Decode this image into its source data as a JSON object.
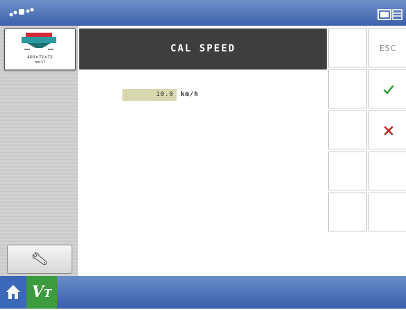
{
  "header": {
    "gps_icon": "satellite-signal-icon",
    "screen_icon": "display-window-icon"
  },
  "sidebar": {
    "device": {
      "line1": "400×72×72",
      "line2": "res:17",
      "icon": "spreader-implement-icon",
      "brand_color": "#d62a3a"
    },
    "tools_icon": "wrench-icon"
  },
  "main": {
    "title": "CAL SPEED",
    "speed_value": "10.0",
    "speed_unit": "km/h"
  },
  "softkeys": {
    "esc_label": "ESC",
    "accept_icon": "checkmark-icon",
    "cancel_icon": "x-icon",
    "accept_color": "#2e9e2e",
    "cancel_color": "#c42a2a"
  },
  "footer": {
    "home_icon": "home-icon",
    "vt_label_main": "V",
    "vt_label_sub": "T"
  }
}
